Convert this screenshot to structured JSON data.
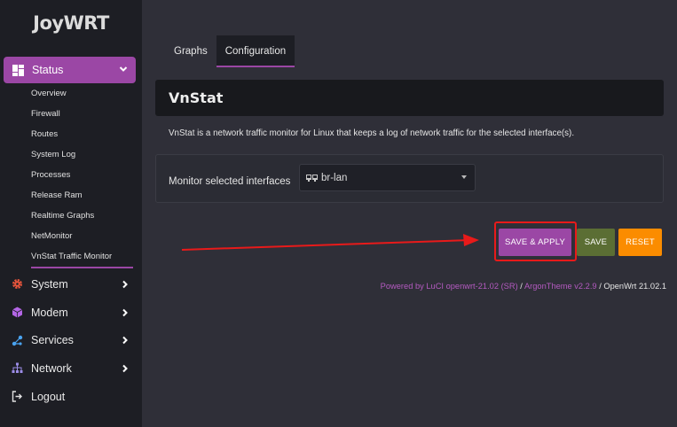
{
  "sidebar": {
    "logo": "JoyWRT",
    "status": {
      "label": "Status",
      "icon": "dashboard-icon"
    },
    "status_items": [
      {
        "label": "Overview"
      },
      {
        "label": "Firewall"
      },
      {
        "label": "Routes"
      },
      {
        "label": "System Log"
      },
      {
        "label": "Processes"
      },
      {
        "label": "Release Ram"
      },
      {
        "label": "Realtime Graphs"
      },
      {
        "label": "NetMonitor"
      },
      {
        "label": "VnStat Traffic Monitor",
        "active": true
      }
    ],
    "menu": [
      {
        "label": "System",
        "icon": "gear-icon",
        "color": "#e9553c"
      },
      {
        "label": "Modem",
        "icon": "cube-icon",
        "color": "#b466e6"
      },
      {
        "label": "Services",
        "icon": "share-icon",
        "color": "#4aa3f0"
      },
      {
        "label": "Network",
        "icon": "sitemap-icon",
        "color": "#9b8ce6"
      },
      {
        "label": "Logout",
        "icon": "logout-icon",
        "color": "#e0e0e0"
      }
    ]
  },
  "tabs": [
    {
      "label": "Graphs",
      "active": false
    },
    {
      "label": "Configuration",
      "active": true
    }
  ],
  "page": {
    "title": "VnStat",
    "description": "VnStat is a network traffic monitor for Linux that keeps a log of network traffic for the selected interface(s).",
    "field_label": "Monitor selected interfaces",
    "selected_interface": "br-lan"
  },
  "buttons": {
    "save_apply": "SAVE & APPLY",
    "save": "SAVE",
    "reset": "RESET"
  },
  "footer": {
    "powered": "Powered by LuCI openwrt-21.02 (SR)",
    "sep1": " / ",
    "theme": "ArgonTheme v2.2.9",
    "sep2": " / ",
    "version": "OpenWrt 21.02.1"
  },
  "colors": {
    "accent": "#9b47a5",
    "save": "#5b6e34",
    "reset": "#fb8c00",
    "annotation": "#e81a1a"
  }
}
